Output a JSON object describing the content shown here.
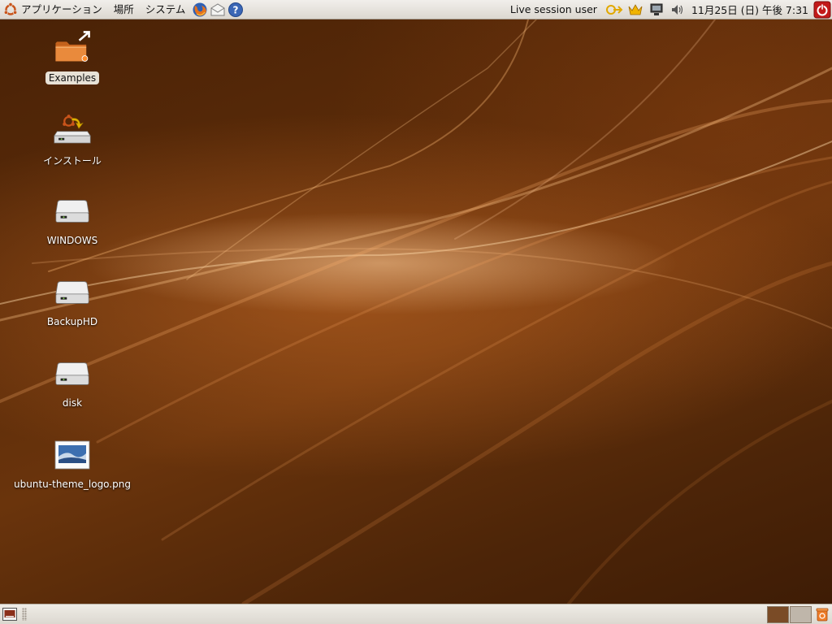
{
  "top_panel": {
    "menus": {
      "applications": "アプリケーション",
      "places": "場所",
      "system": "システム"
    },
    "launchers": [
      "firefox-icon",
      "mail-icon",
      "help-icon"
    ],
    "user": "Live session user",
    "tray_icons": [
      "network-manager-icon",
      "update-notifier-icon",
      "display-icon",
      "volume-icon"
    ],
    "clock": "11月25日 (日) 午後 7:31"
  },
  "desktop": {
    "icons": [
      {
        "label": "Examples",
        "type": "folder-link-icon",
        "selected": true
      },
      {
        "label": "インストール",
        "type": "installer-icon"
      },
      {
        "label": "WINDOWS",
        "type": "drive-icon"
      },
      {
        "label": "BackupHD",
        "type": "drive-icon"
      },
      {
        "label": "disk",
        "type": "drive-icon"
      },
      {
        "label": "ubuntu-theme_logo.png",
        "type": "image-file-icon"
      }
    ]
  },
  "bottom_panel": {
    "workspaces": [
      "workspace-1",
      "workspace-2"
    ],
    "active_workspace": 1
  },
  "colors": {
    "panel": "#e4e0d8",
    "desktop_dark": "#4a2206",
    "desktop_light": "#d98c4a"
  }
}
